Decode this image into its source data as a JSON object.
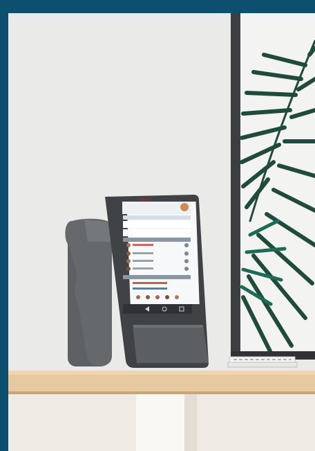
{
  "scene": {
    "description_icons": [
      "desk-phone-icon",
      "handset-icon",
      "palm-leaf-icon"
    ]
  },
  "phone_screen": {
    "brand": "AVAYA"
  }
}
